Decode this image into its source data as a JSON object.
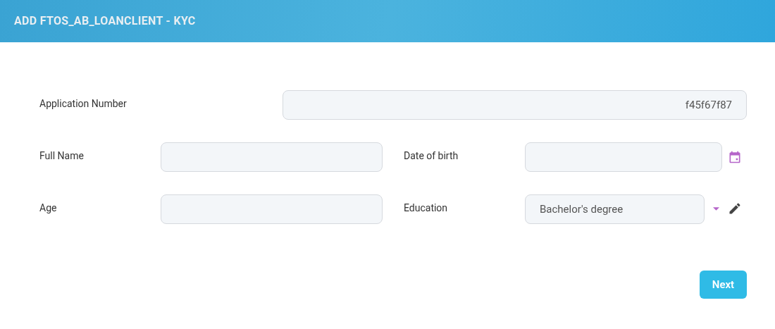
{
  "header": {
    "title": "ADD FTOS_AB_LOANCLIENT - KYC"
  },
  "form": {
    "application_number": {
      "label": "Application Number",
      "value": "f45f67f87"
    },
    "full_name": {
      "label": "Full Name"
    },
    "date_of_birth": {
      "label": "Date of birth"
    },
    "age": {
      "label": "Age"
    },
    "education": {
      "label": "Education",
      "value": "Bachelor's degree"
    }
  },
  "buttons": {
    "next": "Next"
  }
}
